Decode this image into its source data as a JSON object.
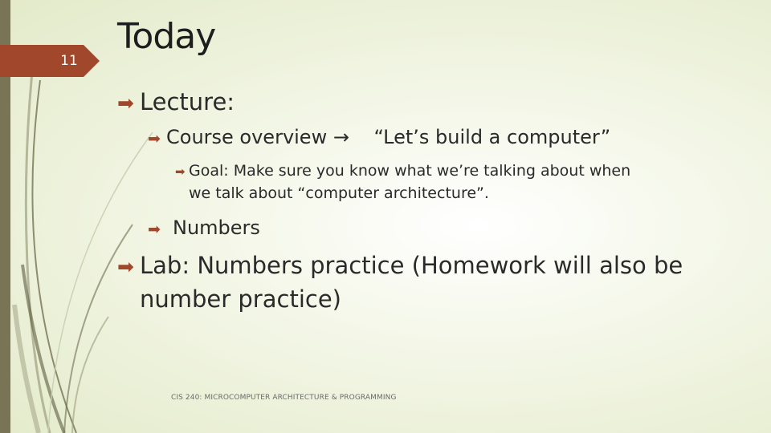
{
  "slide": {
    "page_number": "11",
    "title": "Today",
    "bullets": [
      {
        "level": 1,
        "icon": "arrow-right-icon",
        "text": "Lecture:"
      },
      {
        "level": 2,
        "icon": "arrow-right-icon",
        "text": "Course overview →    “Let’s build a computer”"
      },
      {
        "level": 3,
        "icon": "arrow-right-icon",
        "line1": "Goal: Make sure you know what we’re talking about when",
        "line2": "we talk about “computer architecture”."
      },
      {
        "level": 2,
        "icon": "arrow-right-icon",
        "text": "Numbers"
      },
      {
        "level": 1,
        "icon": "arrow-right-icon",
        "line1": "Lab: Numbers practice (Homework will also be",
        "line2": "number practice)"
      }
    ],
    "footer": "CIS 240: MICROCOMPUTER ARCHITECTURE & PROGRAMMING"
  },
  "colors": {
    "accent": "#a0472c",
    "side_bar": "#7a7456",
    "text": "#2a2a2a",
    "background_center": "#ffffff",
    "background_edge": "#e3eac9"
  }
}
